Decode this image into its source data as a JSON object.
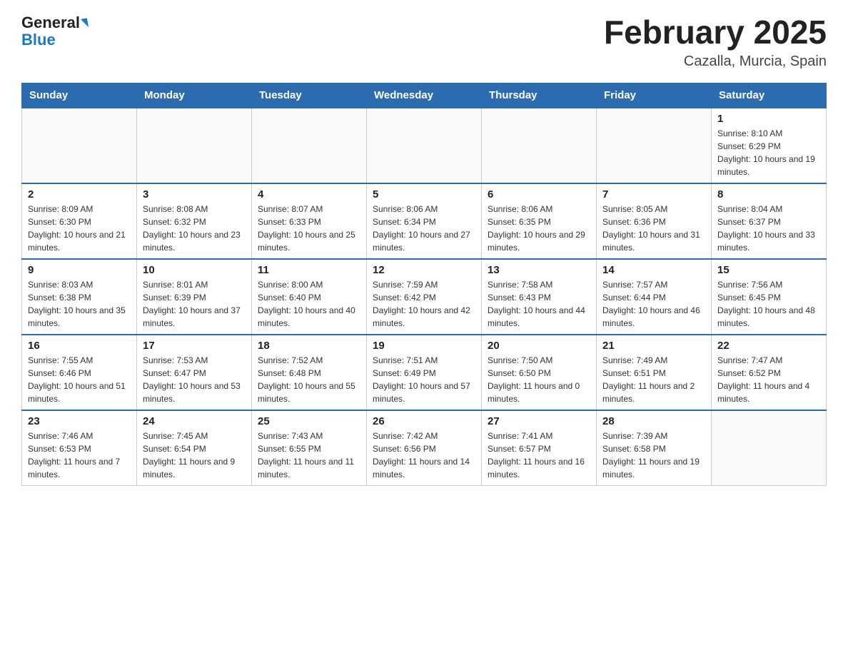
{
  "header": {
    "logo_general": "General",
    "logo_blue": "Blue",
    "title": "February 2025",
    "subtitle": "Cazalla, Murcia, Spain"
  },
  "days_of_week": [
    "Sunday",
    "Monday",
    "Tuesday",
    "Wednesday",
    "Thursday",
    "Friday",
    "Saturday"
  ],
  "weeks": [
    [
      {
        "day": "",
        "info": ""
      },
      {
        "day": "",
        "info": ""
      },
      {
        "day": "",
        "info": ""
      },
      {
        "day": "",
        "info": ""
      },
      {
        "day": "",
        "info": ""
      },
      {
        "day": "",
        "info": ""
      },
      {
        "day": "1",
        "info": "Sunrise: 8:10 AM\nSunset: 6:29 PM\nDaylight: 10 hours and 19 minutes."
      }
    ],
    [
      {
        "day": "2",
        "info": "Sunrise: 8:09 AM\nSunset: 6:30 PM\nDaylight: 10 hours and 21 minutes."
      },
      {
        "day": "3",
        "info": "Sunrise: 8:08 AM\nSunset: 6:32 PM\nDaylight: 10 hours and 23 minutes."
      },
      {
        "day": "4",
        "info": "Sunrise: 8:07 AM\nSunset: 6:33 PM\nDaylight: 10 hours and 25 minutes."
      },
      {
        "day": "5",
        "info": "Sunrise: 8:06 AM\nSunset: 6:34 PM\nDaylight: 10 hours and 27 minutes."
      },
      {
        "day": "6",
        "info": "Sunrise: 8:06 AM\nSunset: 6:35 PM\nDaylight: 10 hours and 29 minutes."
      },
      {
        "day": "7",
        "info": "Sunrise: 8:05 AM\nSunset: 6:36 PM\nDaylight: 10 hours and 31 minutes."
      },
      {
        "day": "8",
        "info": "Sunrise: 8:04 AM\nSunset: 6:37 PM\nDaylight: 10 hours and 33 minutes."
      }
    ],
    [
      {
        "day": "9",
        "info": "Sunrise: 8:03 AM\nSunset: 6:38 PM\nDaylight: 10 hours and 35 minutes."
      },
      {
        "day": "10",
        "info": "Sunrise: 8:01 AM\nSunset: 6:39 PM\nDaylight: 10 hours and 37 minutes."
      },
      {
        "day": "11",
        "info": "Sunrise: 8:00 AM\nSunset: 6:40 PM\nDaylight: 10 hours and 40 minutes."
      },
      {
        "day": "12",
        "info": "Sunrise: 7:59 AM\nSunset: 6:42 PM\nDaylight: 10 hours and 42 minutes."
      },
      {
        "day": "13",
        "info": "Sunrise: 7:58 AM\nSunset: 6:43 PM\nDaylight: 10 hours and 44 minutes."
      },
      {
        "day": "14",
        "info": "Sunrise: 7:57 AM\nSunset: 6:44 PM\nDaylight: 10 hours and 46 minutes."
      },
      {
        "day": "15",
        "info": "Sunrise: 7:56 AM\nSunset: 6:45 PM\nDaylight: 10 hours and 48 minutes."
      }
    ],
    [
      {
        "day": "16",
        "info": "Sunrise: 7:55 AM\nSunset: 6:46 PM\nDaylight: 10 hours and 51 minutes."
      },
      {
        "day": "17",
        "info": "Sunrise: 7:53 AM\nSunset: 6:47 PM\nDaylight: 10 hours and 53 minutes."
      },
      {
        "day": "18",
        "info": "Sunrise: 7:52 AM\nSunset: 6:48 PM\nDaylight: 10 hours and 55 minutes."
      },
      {
        "day": "19",
        "info": "Sunrise: 7:51 AM\nSunset: 6:49 PM\nDaylight: 10 hours and 57 minutes."
      },
      {
        "day": "20",
        "info": "Sunrise: 7:50 AM\nSunset: 6:50 PM\nDaylight: 11 hours and 0 minutes."
      },
      {
        "day": "21",
        "info": "Sunrise: 7:49 AM\nSunset: 6:51 PM\nDaylight: 11 hours and 2 minutes."
      },
      {
        "day": "22",
        "info": "Sunrise: 7:47 AM\nSunset: 6:52 PM\nDaylight: 11 hours and 4 minutes."
      }
    ],
    [
      {
        "day": "23",
        "info": "Sunrise: 7:46 AM\nSunset: 6:53 PM\nDaylight: 11 hours and 7 minutes."
      },
      {
        "day": "24",
        "info": "Sunrise: 7:45 AM\nSunset: 6:54 PM\nDaylight: 11 hours and 9 minutes."
      },
      {
        "day": "25",
        "info": "Sunrise: 7:43 AM\nSunset: 6:55 PM\nDaylight: 11 hours and 11 minutes."
      },
      {
        "day": "26",
        "info": "Sunrise: 7:42 AM\nSunset: 6:56 PM\nDaylight: 11 hours and 14 minutes."
      },
      {
        "day": "27",
        "info": "Sunrise: 7:41 AM\nSunset: 6:57 PM\nDaylight: 11 hours and 16 minutes."
      },
      {
        "day": "28",
        "info": "Sunrise: 7:39 AM\nSunset: 6:58 PM\nDaylight: 11 hours and 19 minutes."
      },
      {
        "day": "",
        "info": ""
      }
    ]
  ]
}
